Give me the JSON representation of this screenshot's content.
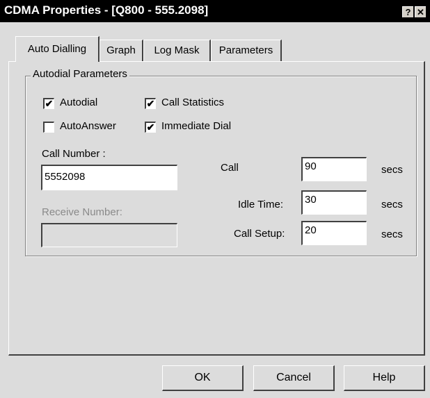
{
  "window": {
    "title": "CDMA Properties - [Q800 - 555.2098]",
    "help_button": "?",
    "close_button": "✕"
  },
  "tabs": [
    {
      "label": "Auto Dialling",
      "active": true
    },
    {
      "label": "Graph",
      "active": false
    },
    {
      "label": "Log Mask",
      "active": false
    },
    {
      "label": "Parameters",
      "active": false
    }
  ],
  "group": {
    "label": "Autodial Parameters"
  },
  "checkboxes": {
    "autodial": {
      "label": "Autodial",
      "checked": true,
      "mark": "✔"
    },
    "call_statistics": {
      "label": "Call Statistics",
      "checked": true,
      "mark": "✔"
    },
    "autoanswer": {
      "label": "AutoAnswer",
      "checked": false,
      "mark": ""
    },
    "immediate_dial": {
      "label": "Immediate Dial",
      "checked": true,
      "mark": "✔"
    }
  },
  "call_number": {
    "label": "Call Number :",
    "value": "5552098"
  },
  "receive_number": {
    "label": "Receive Number:",
    "value": "",
    "disabled": true
  },
  "timers": {
    "call": {
      "label": "Call",
      "value": "90",
      "unit": "secs"
    },
    "idle_time": {
      "label": "Idle Time:",
      "value": "30",
      "unit": "secs"
    },
    "call_setup": {
      "label": "Call Setup:",
      "value": "20",
      "unit": "secs"
    }
  },
  "buttons": {
    "ok": "OK",
    "cancel": "Cancel",
    "help": "Help"
  }
}
